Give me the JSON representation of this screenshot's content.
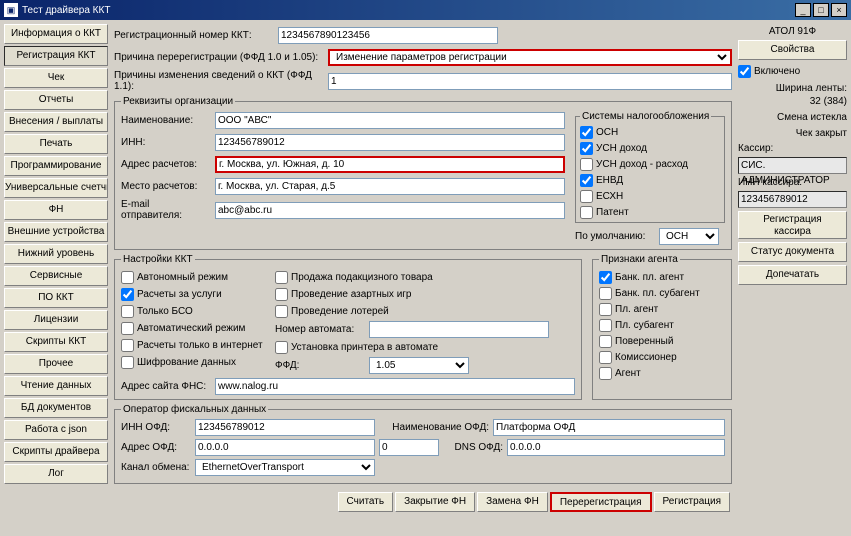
{
  "window": {
    "title": "Тест драйвера ККТ"
  },
  "nav": {
    "items": [
      "Информация о ККТ",
      "Регистрация ККТ",
      "Чек",
      "Отчеты",
      "Внесения / выплаты",
      "Печать",
      "Программирование",
      "Универсальные счетчики",
      "ФН",
      "Внешние устройства",
      "Нижний уровень",
      "Сервисные",
      "ПО ККТ",
      "Лицензии",
      "Скрипты ККТ",
      "Прочее",
      "Чтение данных",
      "БД документов",
      "Работа с json",
      "Скрипты драйвера",
      "Лог"
    ],
    "active_index": 1
  },
  "top_form": {
    "reg_number_label": "Регистрационный номер ККТ:",
    "reg_number": "1234567890123456",
    "rereg_reason_label": "Причина перерегистрации (ФФД 1.0 и 1.05):",
    "rereg_reason": "Изменение параметров регистрации",
    "change_reason_label": "Причины изменения сведений о ККТ (ФФД 1.1):",
    "change_reason": "1"
  },
  "requisites": {
    "legend": "Реквизиты организации",
    "name_label": "Наименование:",
    "name": "ООО \"АВС\"",
    "inn_label": "ИНН:",
    "inn": "123456789012",
    "calc_addr_label": "Адрес расчетов:",
    "calc_addr": "г. Москва, ул. Южная, д. 10",
    "calc_place_label": "Место расчетов:",
    "calc_place": "г. Москва, ул. Старая, д.5",
    "email_label": "E-mail отправителя:",
    "email": "abc@abc.ru"
  },
  "tax": {
    "legend": "Системы налогообложения",
    "osn": "ОСН",
    "usn_dohod": "УСН доход",
    "usn_dr": "УСН доход - расход",
    "envd": "ЕНВД",
    "eshn": "ЕСХН",
    "patent": "Патент",
    "default_label": "По умолчанию:",
    "default": "ОСН"
  },
  "settings": {
    "legend": "Настройки ККТ",
    "autonomous": "Автономный режим",
    "services": "Расчеты за услуги",
    "bso": "Только БСО",
    "auto_mode": "Автоматический режим",
    "internet": "Расчеты только в интернет",
    "encrypt": "Шифрование данных",
    "excise": "Продажа подакцизного товара",
    "gambling": "Проведение азартных игр",
    "lottery": "Проведение лотерей",
    "machine_num_label": "Номер автомата:",
    "printer": "Установка принтера в автомате",
    "ffd_label": "ФФД:",
    "ffd": "1.05",
    "fns_label": "Адрес сайта ФНС:",
    "fns": "www.nalog.ru"
  },
  "agent": {
    "legend": "Признаки агента",
    "bank_agent": "Банк. пл. агент",
    "bank_subagent": "Банк. пл. субагент",
    "pl_agent": "Пл. агент",
    "pl_subagent": "Пл. субагент",
    "attorney": "Поверенный",
    "commissioner": "Комиссионер",
    "agent_chk": "Агент"
  },
  "ofd": {
    "legend": "Оператор фискальных данных",
    "inn_label": "ИНН ОФД:",
    "inn": "123456789012",
    "name_label": "Наименование ОФД:",
    "name": "Платформа ОФД",
    "addr_label": "Адрес ОФД:",
    "addr": "0.0.0.0",
    "port": "0",
    "dns_label": "DNS ОФД:",
    "dns": "0.0.0.0",
    "channel_label": "Канал обмена:",
    "channel": "EthernetOverTransport"
  },
  "bottom": {
    "read": "Считать",
    "close_fn": "Закрытие ФН",
    "change_fn": "Замена ФН",
    "rereg": "Перерегистрация",
    "reg": "Регистрация"
  },
  "right": {
    "model": "АТОЛ 91Ф",
    "props_btn": "Свойства",
    "enabled": "Включено",
    "tape_width": "Ширина ленты:\n32 (384)",
    "shift": "Смена истекла",
    "check": "Чек закрыт",
    "cashier_label": "Кассир:",
    "cashier": "СИС. АДМИНИСТРАТОР",
    "cashier_inn_label": "ИНН кассира:",
    "cashier_inn": "123456789012",
    "reg_cashier_btn": "Регистрация кассира",
    "doc_status_btn": "Статус документа",
    "topup_btn": "Допечатать"
  }
}
